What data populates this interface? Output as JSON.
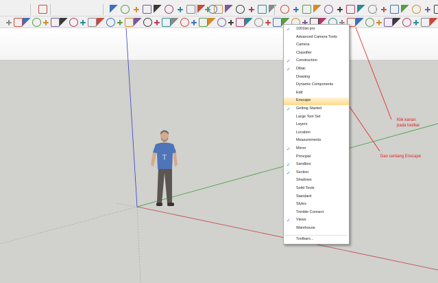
{
  "colors": {
    "menu_highlight": "#ffd98a",
    "check": "#3b6fcf",
    "annotation": "#e21b1b",
    "ground": "#d1d1cd",
    "axis_red": "#c04040",
    "axis_green": "#3a9a3a",
    "axis_blue": "#3a3acc"
  },
  "context_menu": {
    "items": [
      {
        "label": "1001bit pro",
        "checked": true
      },
      {
        "label": "Advanced Camera Tools",
        "checked": false
      },
      {
        "label": "Camera",
        "checked": false
      },
      {
        "label": "Classifier",
        "checked": false
      },
      {
        "label": "Construction",
        "checked": true
      },
      {
        "label": "Dibac",
        "checked": true
      },
      {
        "label": "Drawing",
        "checked": false
      },
      {
        "label": "Dynamic Components",
        "checked": false
      },
      {
        "label": "Edit",
        "checked": false
      },
      {
        "label": "Enscape",
        "checked": false,
        "highlighted": true
      },
      {
        "label": "Getting Started",
        "checked": true
      },
      {
        "label": "Large Tool Set",
        "checked": false
      },
      {
        "label": "Layers",
        "checked": false
      },
      {
        "label": "Location",
        "checked": false
      },
      {
        "label": "Measurements",
        "checked": false
      },
      {
        "label": "Mirror",
        "checked": true
      },
      {
        "label": "Principal",
        "checked": false
      },
      {
        "label": "Sandbox",
        "checked": true
      },
      {
        "label": "Section",
        "checked": true
      },
      {
        "label": "Shadows",
        "checked": false
      },
      {
        "label": "Solid Tools",
        "checked": false
      },
      {
        "label": "Standard",
        "checked": false
      },
      {
        "label": "Styles",
        "checked": false
      },
      {
        "label": "Trimble Connect",
        "checked": false
      },
      {
        "label": "Views",
        "checked": true
      },
      {
        "label": "Warehouse",
        "checked": false
      },
      {
        "label": "Toolbars...",
        "checked": false,
        "separator_before": true
      }
    ]
  },
  "annotations": {
    "note1_line1": "Klik kanan",
    "note1_line2": "pada toolbar",
    "note2": "Dan centang Enscape"
  },
  "scene": {
    "figure": "person-figure",
    "shirt_logo": "T"
  }
}
